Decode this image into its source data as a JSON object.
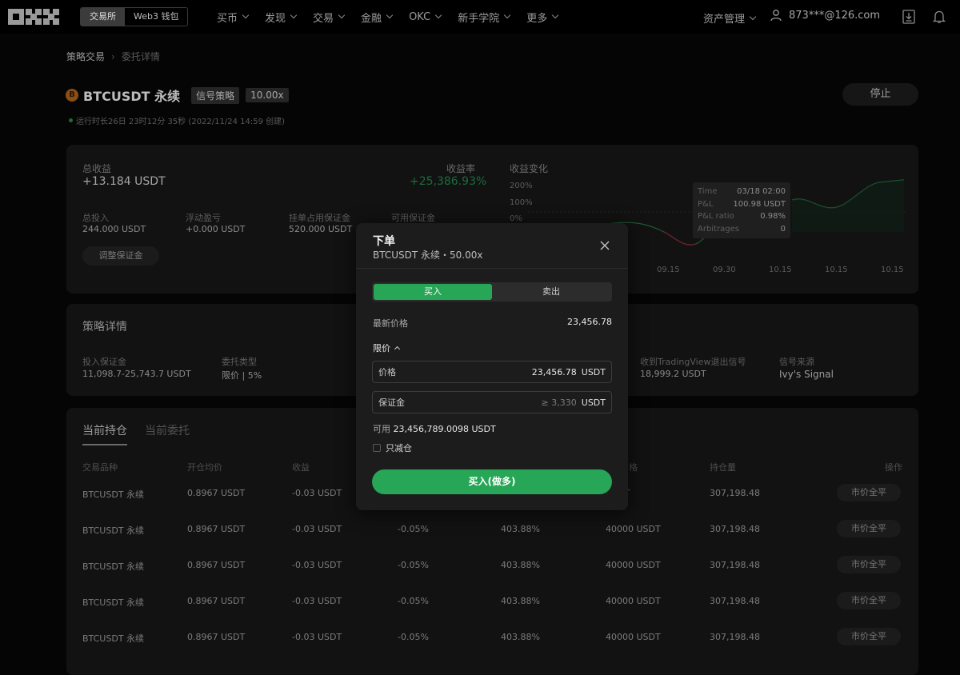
{
  "nav": {
    "logo": "OKX",
    "segment": [
      "交易所",
      "Web3 钱包"
    ],
    "menu": [
      "买币",
      "发现",
      "交易",
      "金融",
      "OKC",
      "新手学院",
      "更多"
    ],
    "assets": "资产管理",
    "user_email": "873***@126.com"
  },
  "page": {
    "breadcrumb": [
      "策略交易",
      "委托详情"
    ],
    "symbol": "BTCUSDT 永续",
    "coin_icon": "B",
    "tags": [
      "信号策略",
      "10.00x"
    ],
    "stop_label": "停止",
    "runtime": "运行时长26日 23时12分 35秒 (2022/11/24 14:59 创建)"
  },
  "summary": {
    "total_profit_label": "总收益",
    "total_profit": "+13.184 USDT",
    "yield_label": "收益率",
    "yield": "+25,386.93%",
    "stats": [
      {
        "label": "总投入",
        "value": "244.000 USDT"
      },
      {
        "label": "浮动盈亏",
        "value": "+0.000 USDT"
      },
      {
        "label": "挂单占用保证金",
        "value": "520.000 USDT"
      },
      {
        "label": "可用保证金",
        "value": ""
      }
    ],
    "adjust_label": "调整保证金",
    "chart_title": "收益变化",
    "y_ticks": [
      "200%",
      "100%",
      "0%"
    ],
    "x_ticks": [
      "09.15",
      "09.30",
      "10.15",
      "10.15",
      "10.15"
    ],
    "tooltip": [
      {
        "k": "Time",
        "v": "03/18 02:00"
      },
      {
        "k": "P&L",
        "v": "100.98 USDT"
      },
      {
        "k": "P&L ratio",
        "v": "0.98%"
      },
      {
        "k": "Arbitrages",
        "v": "0"
      }
    ]
  },
  "details": {
    "title": "策略详情",
    "items": [
      {
        "label": "投入保证金",
        "value": "11,098.7-25,743.7 USDT"
      },
      {
        "label": "委托类型",
        "value": "限价 | 5%"
      },
      {
        "label": "收到TradingView退出信号",
        "value": "18,999.2 USDT"
      },
      {
        "label": "信号来源",
        "value": "Ivy's Signal"
      }
    ]
  },
  "positions": {
    "tabs": [
      "当前持仓",
      "当前委托"
    ],
    "headers": [
      "交易品种",
      "开仓均价",
      "收益",
      "格",
      "持仓量",
      "操作"
    ],
    "rows": [
      [
        "BTCUSDT 永续",
        "0.8967 USDT",
        "-0.03 USDT",
        "",
        "",
        "USDT",
        "307,198.48"
      ],
      [
        "BTCUSDT 永续",
        "0.8967 USDT",
        "-0.03 USDT",
        "-0.05%",
        "403.88%",
        "40000 USDT",
        "307,198.48"
      ],
      [
        "BTCUSDT 永续",
        "0.8967 USDT",
        "-0.03 USDT",
        "-0.05%",
        "403.88%",
        "40000 USDT",
        "307,198.48"
      ],
      [
        "BTCUSDT 永续",
        "0.8967 USDT",
        "-0.03 USDT",
        "-0.05%",
        "403.88%",
        "40000 USDT",
        "307,198.48"
      ],
      [
        "BTCUSDT 永续",
        "0.8967 USDT",
        "-0.03 USDT",
        "-0.05%",
        "403.88%",
        "40000 USDT",
        "307,198.48"
      ]
    ],
    "action_label": "市价全平"
  },
  "modal": {
    "title": "下单",
    "subtitle": "BTCUSDT 永续・50.00x",
    "buy": "买入",
    "sell": "卖出",
    "latest_label": "最新价格",
    "latest_price": "23,456.78",
    "order_type": "限价",
    "price_label": "价格",
    "price_value": "23,456.78",
    "price_unit": "USDT",
    "margin_label": "保证金",
    "margin_placeholder": "≥ 3,330",
    "margin_unit": "USDT",
    "available_label": "可用",
    "available_value": "23,456,789.0098 USDT",
    "reduce_only": "只减仓",
    "submit": "买入(做多)"
  },
  "colors": {
    "buy_green": "#27a657",
    "bg": "#050505",
    "modal_bg": "#1c1c1c"
  }
}
